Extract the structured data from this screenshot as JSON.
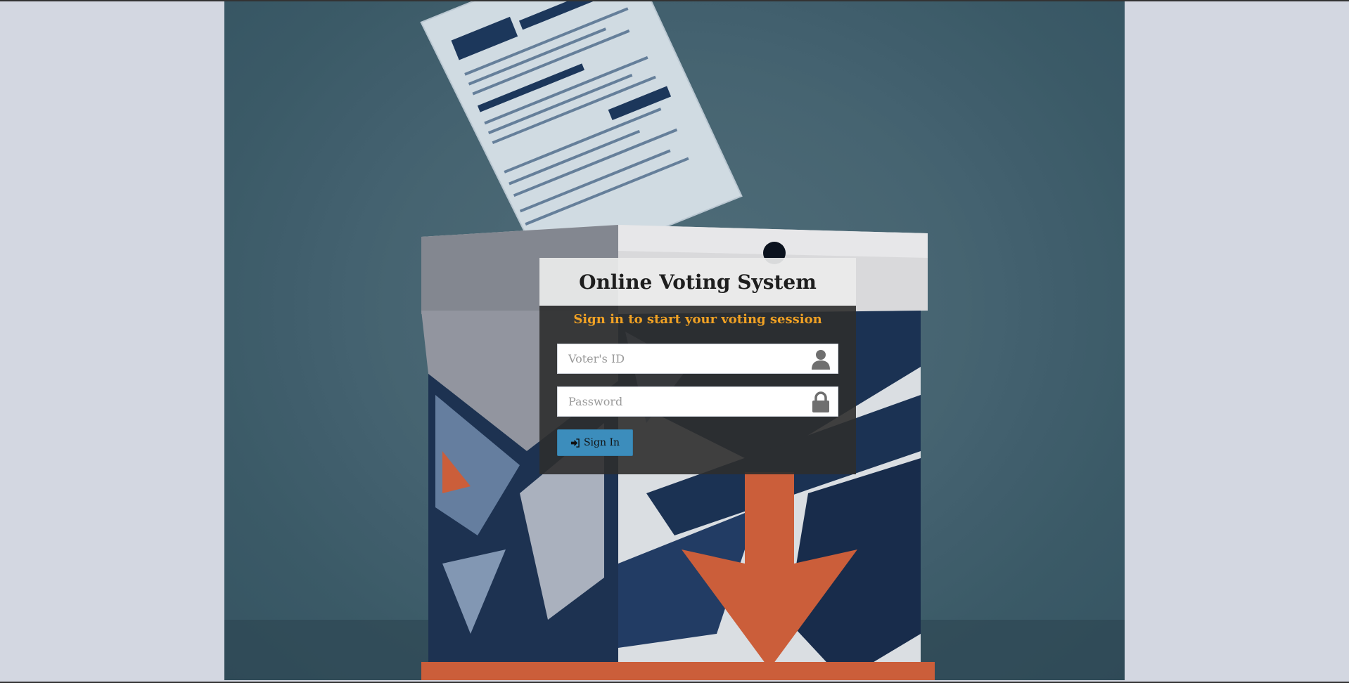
{
  "login": {
    "title": "Online Voting System",
    "message": "Sign in to start your voting session",
    "voter_id": {
      "value": "",
      "placeholder": "Voter's ID",
      "icon": "user-icon"
    },
    "password": {
      "value": "",
      "placeholder": "Password",
      "icon": "lock-icon"
    },
    "submit": {
      "label": "Sign In",
      "icon": "sign-in-icon"
    }
  },
  "colors": {
    "page_background": "#d3d7e1",
    "hero_background": "#4a6a78",
    "accent_message": "#f0a124",
    "button": "#3c8dbc",
    "ballot_box_navy": "#1d3558",
    "ballot_box_orange": "#d6643e"
  }
}
